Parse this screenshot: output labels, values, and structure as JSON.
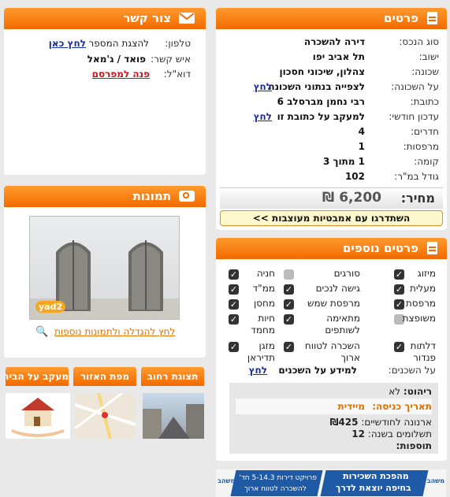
{
  "details": {
    "title": "פרטים",
    "rows": [
      {
        "label": "סוג הנכס:",
        "value": "דירה להשכרה"
      },
      {
        "label": "ישוב:",
        "value": "תל אביב יפו"
      },
      {
        "label": "שכונה:",
        "value": "צהלון, שיכוני חסכון"
      },
      {
        "label": "על השכונה:",
        "value": "לצפייה בנתוני השכונה",
        "link": "לחץ"
      },
      {
        "label": "כתובת:",
        "value": "רבי נחמן מברסלב 6"
      },
      {
        "label": "עדכון חודשי:",
        "value": "למעקב על כתובת זו",
        "link": "לחץ"
      },
      {
        "label": "חדרים:",
        "value": "4"
      },
      {
        "label": "מרפסות:",
        "value": "1"
      },
      {
        "label": "קומה:",
        "value": "1 מתוך 3"
      },
      {
        "label": "גודל במ\"ר:",
        "value": "102"
      }
    ],
    "price_label": "מחיר:",
    "price_value": "6,200 ₪",
    "cta": "השתדרגו עם אמבטיות מעוצבות >>"
  },
  "extra": {
    "title": "פרטים נוספים",
    "features": [
      {
        "label": "מיזוג",
        "checked": true
      },
      {
        "label": "סורגים",
        "checked": false
      },
      {
        "label": "חניה",
        "checked": true
      },
      {
        "label": "מעלית",
        "checked": true
      },
      {
        "label": "גישה לנכים",
        "checked": true
      },
      {
        "label": "ממ\"ד",
        "checked": true
      },
      {
        "label": "מרפסת",
        "checked": true
      },
      {
        "label": "מרפסת שמש",
        "checked": true
      },
      {
        "label": "מחסן",
        "checked": true
      },
      {
        "label": "משופצת",
        "checked": false
      },
      {
        "label": "מתאימה לשותפים",
        "checked": true
      },
      {
        "label": "חיות מחמד",
        "checked": true
      },
      {
        "label": "דלתות פנדור",
        "checked": true
      },
      {
        "label": "השכרה לטווח ארוך",
        "checked": true
      },
      {
        "label": "מזגן תדיראן",
        "checked": true
      }
    ],
    "tenants_label": "על השכנים:",
    "tenants_text": "למידע על השכנים",
    "tenants_link": "לחץ",
    "info": {
      "furnished_label": "ריהוט:",
      "furnished_value": "לא",
      "entry_label": "תאריך כניסה:",
      "entry_value": "מיידית",
      "arnona_label": "ארנונה לחודשיים:",
      "arnona_value": "₪425",
      "payments_label": "תשלומים בשנה:",
      "payments_value": "12",
      "additions_label": "תוספות:"
    }
  },
  "contact": {
    "title": "צור קשר",
    "phone_label": "טלפון:",
    "phone_text": "להצגת המספר",
    "phone_link": "לחץ כאן",
    "person_label": "איש קשר:",
    "person_value": "פואד / ג'מאל",
    "email_label": "דוא\"ל:",
    "email_link": "פנה למפרסם"
  },
  "photos": {
    "title": "תמונות",
    "watermark": "yad2",
    "enlarge_link": "לחץ להגדלה ולתמונות נוספות"
  },
  "tabs": [
    {
      "label": "תצוגת רחוב"
    },
    {
      "label": "מפת האזור"
    },
    {
      "label": "מעקב על הבית"
    }
  ],
  "banner": {
    "main_line1": "מהפכת השכירות",
    "main_line2": "בחיפה יוצאת לדרך",
    "side_line1": "פרויקט דירות 5-14.3 חד'",
    "side_line2": "להשכרה לטווח ארוך",
    "logo": "משהב"
  },
  "colors": {
    "accent": "#f26a00",
    "link": "#1a2e9e",
    "red_link": "#c4161c"
  }
}
